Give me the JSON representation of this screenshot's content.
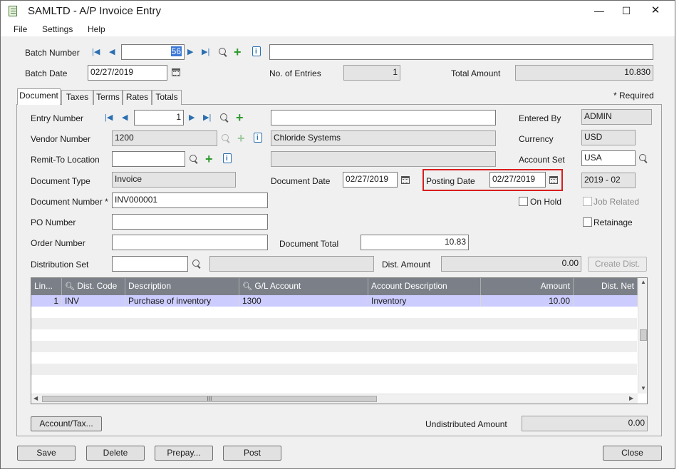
{
  "window": {
    "title": "SAMLTD - A/P Invoice Entry",
    "minimize": "—",
    "maximize": "☐",
    "close": "✕"
  },
  "menu": {
    "file": "File",
    "settings": "Settings",
    "help": "Help"
  },
  "header": {
    "batch_number_label": "Batch Number",
    "batch_number": "56",
    "batch_description": "",
    "batch_date_label": "Batch Date",
    "batch_date": "02/27/2019",
    "entries_label": "No. of Entries",
    "entries": "1",
    "total_amount_label": "Total Amount",
    "total_amount": "10.830"
  },
  "tabs": [
    {
      "label": "Document"
    },
    {
      "label": "Taxes"
    },
    {
      "label": "Terms"
    },
    {
      "label": "Rates"
    },
    {
      "label": "Totals"
    }
  ],
  "required_note": "* Required",
  "document": {
    "entry_number_label": "Entry Number",
    "entry_number": "1",
    "entry_description": "",
    "entered_by_label": "Entered By",
    "entered_by": "ADMIN",
    "vendor_number_label": "Vendor Number",
    "vendor_number": "1200",
    "vendor_name": "Chloride Systems",
    "currency_label": "Currency",
    "currency": "USD",
    "remit_to_label": "Remit-To Location",
    "remit_to": "",
    "remit_to_name": "",
    "account_set_label": "Account Set",
    "account_set": "USA",
    "document_type_label": "Document Type",
    "document_type": "Invoice",
    "document_date_label": "Document Date",
    "document_date": "02/27/2019",
    "posting_date_label": "Posting Date",
    "posting_date": "02/27/2019",
    "fiscal_period": "2019 - 02",
    "document_number_label": "Document Number",
    "document_number_star": "*",
    "document_number": "INV000001",
    "on_hold_label": "On Hold",
    "job_related_label": "Job Related",
    "po_number_label": "PO Number",
    "po_number": "",
    "retainage_label": "Retainage",
    "order_number_label": "Order Number",
    "order_number": "",
    "document_total_label": "Document Total",
    "document_total": "10.83",
    "distribution_set_label": "Distribution Set",
    "distribution_set": "",
    "distribution_set_desc": "",
    "dist_amount_label": "Dist. Amount",
    "dist_amount": "0.00",
    "create_dist_label": "Create Dist."
  },
  "grid": {
    "columns": [
      "Lin...",
      "Dist. Code",
      "Description",
      "G/L Account",
      "Account Description",
      "Amount",
      "Dist. Net"
    ],
    "rows": [
      {
        "line": "1",
        "dist_code": "INV",
        "description": "Purchase of inventory",
        "gl_account": "1300",
        "account_description": "Inventory",
        "amount": "10.00",
        "dist_net": ""
      }
    ],
    "scroll_mark": "III"
  },
  "footer": {
    "account_tax_label": "Account/Tax...",
    "undistributed_label": "Undistributed Amount",
    "undistributed_amount": "0.00",
    "save_label": "Save",
    "delete_label": "Delete",
    "prepay_label": "Prepay...",
    "post_label": "Post",
    "close_label": "Close"
  },
  "colors": {
    "accent": "#2a6fb0",
    "selected_row": "#ccccff",
    "grid_header": "#7b8088",
    "highlight": "#d81e1e"
  }
}
